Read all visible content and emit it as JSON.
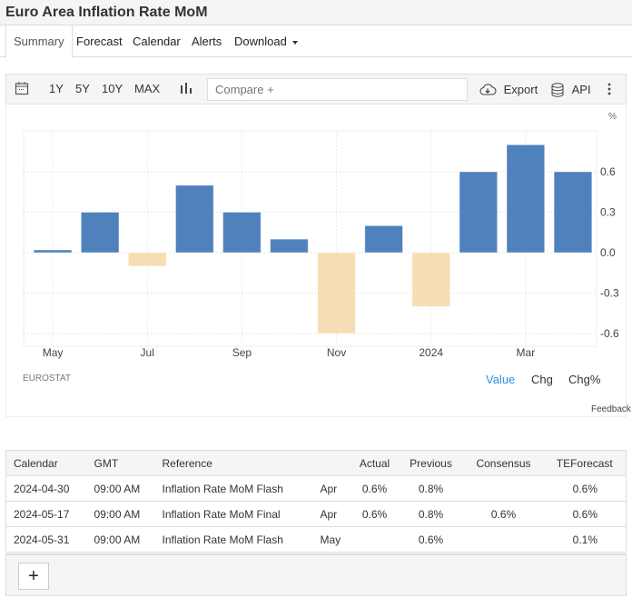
{
  "title": "Euro Area Inflation Rate MoM",
  "tabs": [
    {
      "label": "Summary",
      "active": true
    },
    {
      "label": "Forecast"
    },
    {
      "label": "Calendar"
    },
    {
      "label": "Alerts"
    },
    {
      "label": "Download"
    }
  ],
  "toolbar": {
    "calendar_icon": "calendar-icon",
    "ranges": [
      "1Y",
      "5Y",
      "10Y",
      "MAX"
    ],
    "chart_type_icon": "bar-chart-icon",
    "compare_placeholder": "Compare +",
    "export_label": "Export",
    "api_label": "API",
    "more_icon": "more-vertical-icon"
  },
  "chart_data": {
    "type": "bar",
    "title": "Euro Area Inflation Rate MoM",
    "ylabel": "%",
    "xlabel": "",
    "categories": [
      "2023-05",
      "2023-06",
      "2023-07",
      "2023-08",
      "2023-09",
      "2023-10",
      "2023-11",
      "2023-12",
      "2024-01",
      "2024-02",
      "2024-03",
      "2024-04"
    ],
    "values": [
      0.02,
      0.3,
      -0.1,
      0.5,
      0.3,
      0.1,
      -0.6,
      0.2,
      -0.4,
      0.6,
      0.8,
      0.6
    ],
    "x_tick_labels": [
      {
        "label": "May",
        "index": 0
      },
      {
        "label": "Jul",
        "index": 2
      },
      {
        "label": "Sep",
        "index": 4
      },
      {
        "label": "Nov",
        "index": 6
      },
      {
        "label": "2024",
        "index": 8
      },
      {
        "label": "Mar",
        "index": 10
      }
    ],
    "y_ticks": [
      0.6,
      0.3,
      0.0,
      -0.3,
      -0.6
    ],
    "y_tick_labels": [
      "0.6",
      "0.3",
      "0.0",
      "-0.3",
      "-0.6"
    ],
    "ylim": [
      -0.68,
      0.92
    ],
    "grid": true,
    "y_axis_side": "right",
    "colors": {
      "positive": "#4f81bd",
      "negative": "#f5deb3"
    }
  },
  "source": "EUROSTAT",
  "modes": [
    {
      "label": "Value",
      "active": true
    },
    {
      "label": "Chg"
    },
    {
      "label": "Chg%"
    }
  ],
  "feedback": "Feedback",
  "calendar": {
    "headers": [
      "Calendar",
      "GMT",
      "Reference",
      "",
      "Actual",
      "Previous",
      "Consensus",
      "TEForecast"
    ],
    "rows": [
      [
        "2024-04-30",
        "09:00 AM",
        "Inflation Rate MoM Flash",
        "Apr",
        "0.6%",
        "0.8%",
        "",
        "0.6%"
      ],
      [
        "2024-05-17",
        "09:00 AM",
        "Inflation Rate MoM Final",
        "Apr",
        "0.6%",
        "0.8%",
        "0.6%",
        "0.6%"
      ],
      [
        "2024-05-31",
        "09:00 AM",
        "Inflation Rate MoM Flash",
        "May",
        "",
        "0.6%",
        "",
        "0.1%"
      ]
    ],
    "add_label": "+"
  },
  "accent_color": "#2d8fe0"
}
